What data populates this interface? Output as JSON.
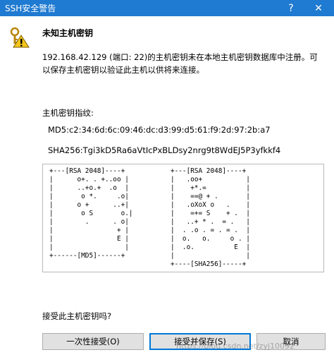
{
  "window": {
    "title": "SSH安全警告",
    "help_glyph": "?",
    "close_glyph": "✕"
  },
  "icon": "warning-keys-icon",
  "heading": "未知主机密钥",
  "description": "192.168.42.129 (端口: 22)的主机密钥未在本地主机密钥数据库中注册。可以保存主机密钥以验证此主机以供将来连接。",
  "fingerprint": {
    "label": "主机密钥指纹:",
    "md5": "MD5:c2:34:6d:6c:09:46:dc:d3:99:d5:61:f9:2d:97:2b:a7",
    "sha256": "SHA256:Tgi3kD5Ra6aVtIcPxBLDsy2nrg9t8WdEJ5P3yfkkf4"
  },
  "randomart": {
    "md5": "+---[RSA 2048]----+\n|      o+. . +..oo |\n|      ..+o.+  .o  |\n|       o *.     .o|\n|      o +      ..+|\n|       o S       o.|\n|        .      . o|\n|                + |\n|                E |\n|                  |\n+------[MD5]------+",
    "sha256": "+---[RSA 2048]----+\n|   .oo+           |\n|    +*.=          |\n|    ==@ + .       |\n|   .oXoX o   .    |\n|    =+= S    + .  |\n|   ..+ * .  = .   |\n|  . .o . = . = .  |\n|  o.   o.     o . |\n|  .o.          E  |\n|                  |\n+----[SHA256]-----+"
  },
  "question": "接受此主机密钥吗?",
  "buttons": {
    "accept_once": "一次性接受(O)",
    "accept_save": "接受并保存(S)",
    "cancel": "取消"
  },
  "watermark": "https://blog.csdn.net/zyj10092",
  "colors": {
    "titlebar": "#1f7ad1",
    "default_button_border": "#0078d7",
    "button_bg": "#e1e1e1"
  }
}
